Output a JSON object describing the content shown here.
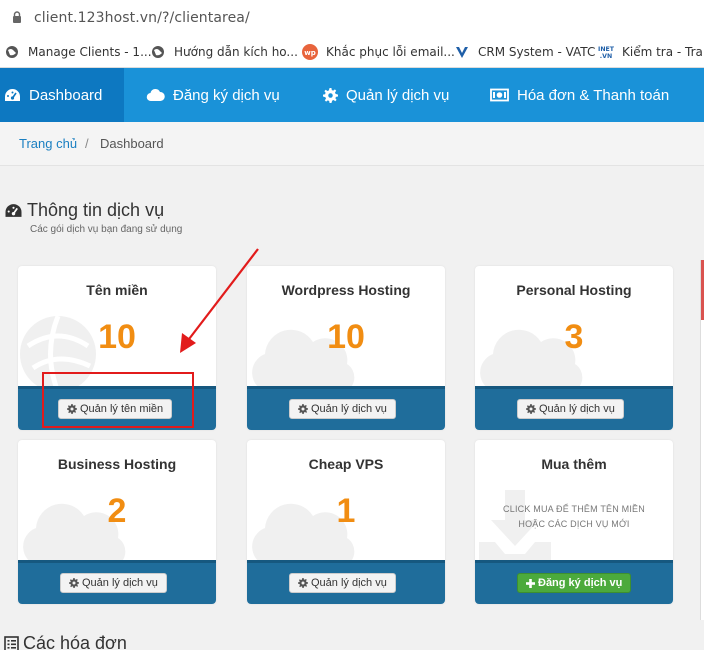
{
  "browser": {
    "url": "client.123host.vn/?/clientarea/",
    "bookmarks": [
      {
        "label": "Manage Clients - 1...",
        "icon": "globe-icon"
      },
      {
        "label": "Hướng dẫn kích ho...",
        "icon": "globe-icon"
      },
      {
        "label": "Khắc phục lỗi email...",
        "icon": "wp-icon"
      },
      {
        "label": "CRM System - VATC",
        "icon": "vatc-icon"
      },
      {
        "label": "Kiểm tra - Tra c",
        "icon": "inet-icon"
      }
    ]
  },
  "nav": {
    "items": [
      {
        "label": "Dashboard",
        "icon": "dashboard-icon"
      },
      {
        "label": "Đăng ký dịch vụ",
        "icon": "cloud-icon"
      },
      {
        "label": "Quản lý dịch vụ",
        "icon": "gear-icon"
      },
      {
        "label": "Hóa đơn & Thanh toán",
        "icon": "money-icon"
      }
    ]
  },
  "breadcrumb": {
    "home": "Trang chủ",
    "separator": "/",
    "current": "Dashboard"
  },
  "section": {
    "title": "Thông tin dịch vụ",
    "subtitle": "Các gói dịch vụ bạn đang sử dụng"
  },
  "cards": [
    {
      "title": "Tên miền",
      "count": "10",
      "button": "Quản lý tên miền"
    },
    {
      "title": "Wordpress Hosting",
      "count": "10",
      "button": "Quản lý dịch vụ"
    },
    {
      "title": "Personal Hosting",
      "count": "3",
      "button": "Quản lý dịch vụ"
    },
    {
      "title": "Business Hosting",
      "count": "2",
      "button": "Quản lý dịch vụ"
    },
    {
      "title": "Cheap VPS",
      "count": "1",
      "button": "Quản lý dịch vụ"
    },
    {
      "title": "Mua thêm",
      "note_line1": "Click mua để thêm tên miền",
      "note_line2": "hoặc các dịch vụ mới",
      "button": "Đăng ký dịch vụ"
    }
  ],
  "invoices": {
    "title": "Các hóa đơn"
  },
  "colors": {
    "nav": "#1a92d8",
    "nav_active": "#0d78c1",
    "count": "#f18d12",
    "card_footer": "#1f6d9b",
    "green_button": "#4caa3c",
    "annotation": "#e21b1b"
  }
}
